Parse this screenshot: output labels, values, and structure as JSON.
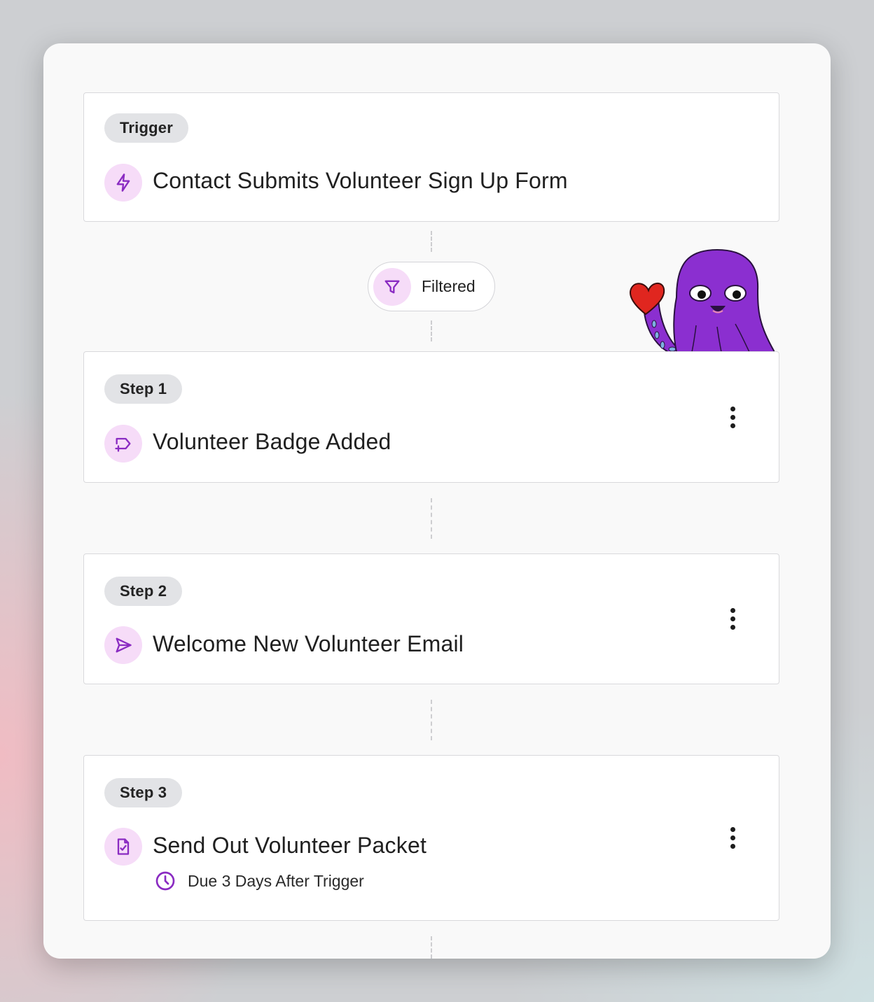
{
  "trigger": {
    "badge": "Trigger",
    "title": "Contact Submits Volunteer Sign Up Form",
    "icon": "lightning-bolt-icon"
  },
  "filter": {
    "label": "Filtered",
    "icon": "funnel-icon"
  },
  "steps": [
    {
      "badge": "Step 1",
      "title": "Volunteer Badge Added",
      "icon": "tag-plus-icon"
    },
    {
      "badge": "Step 2",
      "title": "Welcome New Volunteer Email",
      "icon": "send-icon"
    },
    {
      "badge": "Step 3",
      "title": "Send Out Volunteer Packet",
      "icon": "document-check-icon",
      "due": "Due 3 Days After Trigger",
      "due_icon": "clock-icon"
    }
  ],
  "colors": {
    "accent": "#8a2bc2",
    "icon_bg": "#f6dcf8",
    "badge_bg": "#e2e3e6",
    "mascot": "#8b2fd0"
  }
}
